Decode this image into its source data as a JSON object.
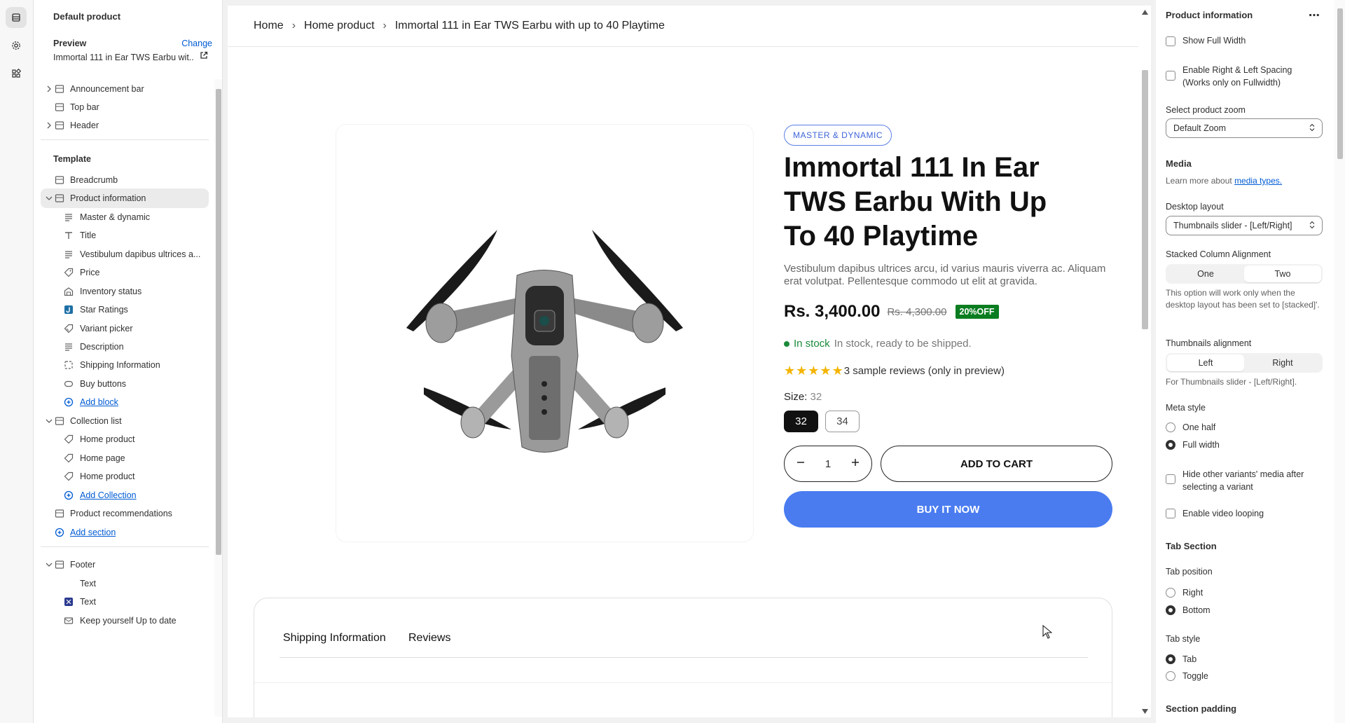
{
  "sidebar": {
    "title": "Default product",
    "preview_label": "Preview",
    "change_label": "Change",
    "preview_value": "Immortal 111 in Ear TWS Earbu wit...",
    "items": [
      {
        "label": "Announcement bar"
      },
      {
        "label": "Top bar"
      },
      {
        "label": "Header"
      },
      {
        "label": "Template"
      },
      {
        "label": "Breadcrumb"
      },
      {
        "label": "Product information"
      },
      {
        "label": "Master & dynamic"
      },
      {
        "label": "Title"
      },
      {
        "label": "Vestibulum dapibus ultrices a..."
      },
      {
        "label": "Price"
      },
      {
        "label": "Inventory status"
      },
      {
        "label": "Star Ratings"
      },
      {
        "label": "Variant picker"
      },
      {
        "label": "Description"
      },
      {
        "label": "Shipping Information"
      },
      {
        "label": "Buy buttons"
      },
      {
        "label": "Add block"
      },
      {
        "label": "Collection list"
      },
      {
        "label": "Home product"
      },
      {
        "label": "Home page"
      },
      {
        "label": "Home product"
      },
      {
        "label": "Add Collection"
      },
      {
        "label": "Product recommendations"
      },
      {
        "label": "Add section"
      },
      {
        "label": "Footer"
      },
      {
        "label": "Text"
      },
      {
        "label": "Text"
      },
      {
        "label": "Keep yourself Up to date"
      }
    ]
  },
  "preview": {
    "breadcrumb": [
      "Home",
      "Home product",
      "Immortal 111 in Ear TWS Earbu with up to 40 Playtime"
    ],
    "vendor": "MASTER & DYNAMIC",
    "title": "Immortal 111 In Ear TWS Earbu With Up To 40 Playtime",
    "description": "Vestibulum dapibus ultrices arcu, id varius mauris viverra ac. Aliquam erat volutpat. Pellentesque commodo ut elit at gravida.",
    "price": "Rs. 3,400.00",
    "compare_price": "Rs. 4,300.00",
    "sale_badge": "20%OFF",
    "stock_status": "In stock",
    "stock_message": "In stock, ready to be shipped.",
    "rating": 5,
    "reviews_text": "3 sample reviews (only in preview)",
    "size_label": "Size:",
    "size_value": "32",
    "sizes": [
      "32",
      "34"
    ],
    "quantity": "1",
    "add_to_cart": "ADD TO CART",
    "buy_now": "BUY IT NOW",
    "tabs": [
      "Shipping Information",
      "Reviews"
    ]
  },
  "settings": {
    "header": "Product information",
    "show_full_width": "Show Full Width",
    "enable_spacing": "Enable Right & Left Spacing (Works only on Fullwidth)",
    "zoom_label": "Select product zoom",
    "zoom_value": "Default Zoom",
    "media_heading": "Media",
    "media_help_prefix": "Learn more about ",
    "media_help_link": "media types.",
    "desktop_layout_label": "Desktop layout",
    "desktop_layout_value": "Thumbnails slider - [Left/Right]",
    "stacked_label": "Stacked Column Alignment",
    "stacked_options": [
      "One",
      "Two"
    ],
    "stacked_help": "This option will work only when the desktop layout has been set to [stacked]'.",
    "thumb_align_label": "Thumbnails alignment",
    "thumb_align_options": [
      "Left",
      "Right"
    ],
    "thumb_align_help": "For Thumbnails slider - [Left/Right].",
    "meta_style_label": "Meta style",
    "meta_style_options": [
      "One half",
      "Full width"
    ],
    "hide_variants": "Hide other variants' media after selecting a variant",
    "video_loop": "Enable video looping",
    "tab_section_heading": "Tab Section",
    "tab_position_label": "Tab position",
    "tab_position_options": [
      "Right",
      "Bottom"
    ],
    "tab_style_label": "Tab style",
    "tab_style_options": [
      "Tab",
      "Toggle"
    ],
    "section_padding_heading": "Section padding"
  },
  "colors": {
    "accent_blue": "#4a7cf0",
    "link_blue": "#005bd3",
    "sale_green": "#0a7d20",
    "star_yellow": "#f4b400"
  }
}
